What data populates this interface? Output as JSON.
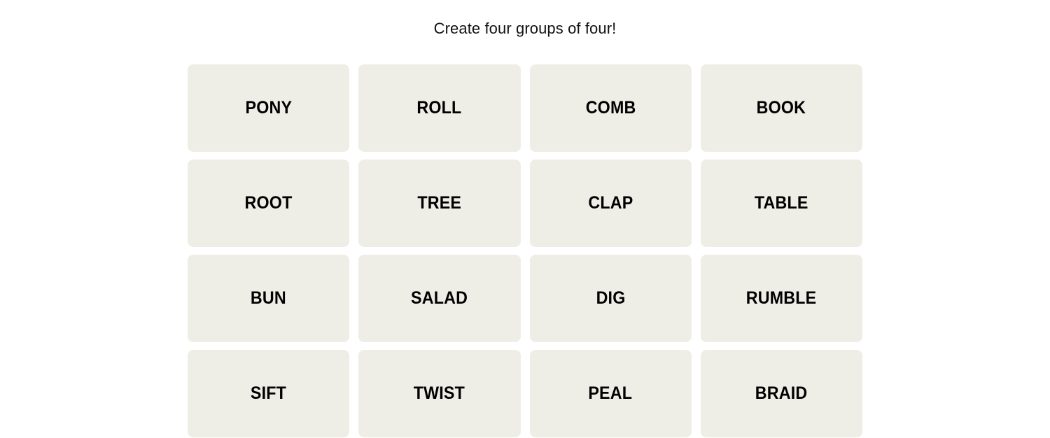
{
  "game": {
    "instruction": "Create four groups of four!",
    "grid": {
      "rows": 4,
      "columns": 4
    },
    "colors": {
      "page_background": "#FFFFFF",
      "tile_background": "#EFEEE6",
      "tile_text": "#000000",
      "instruction_text": "#121212"
    },
    "tiles": [
      {
        "label": "PONY"
      },
      {
        "label": "ROLL"
      },
      {
        "label": "COMB"
      },
      {
        "label": "BOOK"
      },
      {
        "label": "ROOT"
      },
      {
        "label": "TREE"
      },
      {
        "label": "CLAP"
      },
      {
        "label": "TABLE"
      },
      {
        "label": "BUN"
      },
      {
        "label": "SALAD"
      },
      {
        "label": "DIG"
      },
      {
        "label": "RUMBLE"
      },
      {
        "label": "SIFT"
      },
      {
        "label": "TWIST"
      },
      {
        "label": "PEAL"
      },
      {
        "label": "BRAID"
      }
    ]
  }
}
